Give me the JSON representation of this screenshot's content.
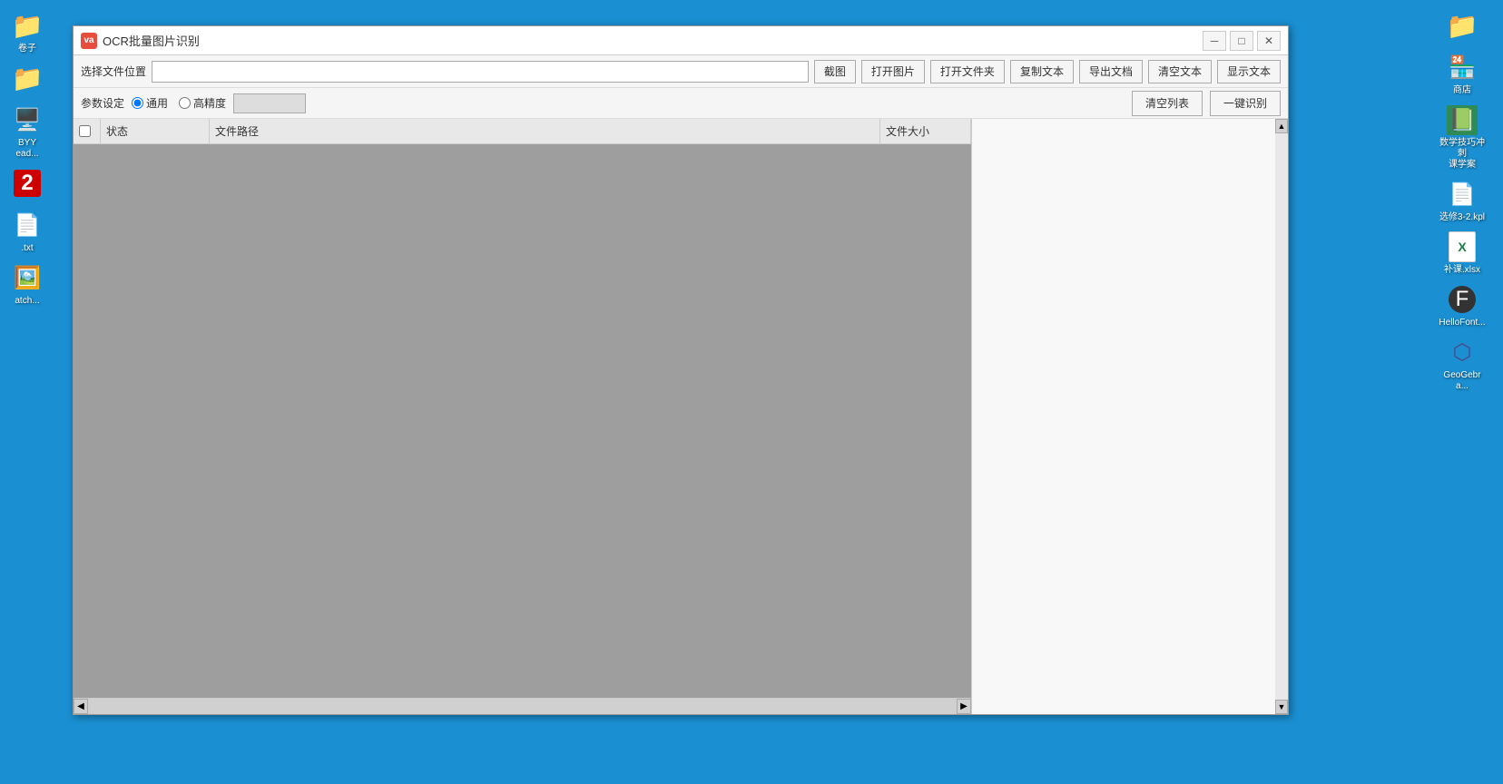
{
  "desktop": {
    "bg_color": "#1a8fd1",
    "left_icons": [
      {
        "id": "icon-1",
        "label": "卷子",
        "emoji": "📁"
      },
      {
        "id": "icon-2",
        "label": "",
        "emoji": "📁"
      },
      {
        "id": "icon-3",
        "label": "BYY\nead...",
        "emoji": "📁"
      },
      {
        "id": "icon-4",
        "label": "",
        "emoji": "🖼️"
      },
      {
        "id": "icon-5",
        "label": ".txt",
        "emoji": "📄"
      },
      {
        "id": "icon-6",
        "label": "atch...",
        "emoji": "🖼️"
      }
    ],
    "right_icons": [
      {
        "id": "r-icon-1",
        "label": "商店",
        "emoji": "🏪"
      },
      {
        "id": "r-icon-2",
        "label": "数学技巧冲刺\n课学案",
        "emoji": "📗"
      },
      {
        "id": "r-icon-3",
        "label": "选修3-2.kpl",
        "emoji": "📄"
      },
      {
        "id": "r-icon-4",
        "label": "补课.xlsx",
        "emoji": "📊"
      },
      {
        "id": "r-icon-5",
        "label": "HelloFont...",
        "emoji": "🔤"
      },
      {
        "id": "r-icon-6",
        "label": "GeoGebra...",
        "emoji": "⬡"
      }
    ]
  },
  "window": {
    "title": "OCR批量图片识别",
    "app_icon_text": "va",
    "min_label": "─",
    "max_label": "□",
    "close_label": "✕"
  },
  "toolbar": {
    "file_location_label": "选择文件位置",
    "file_location_value": "",
    "buttons": [
      {
        "id": "btn-screenshot",
        "label": "截图"
      },
      {
        "id": "btn-open-image",
        "label": "打开图片"
      },
      {
        "id": "btn-open-folder",
        "label": "打开文件夹"
      },
      {
        "id": "btn-copy-text",
        "label": "复制文本"
      },
      {
        "id": "btn-export-doc",
        "label": "导出文档"
      },
      {
        "id": "btn-clear-text",
        "label": "清空文本"
      },
      {
        "id": "btn-show-text",
        "label": "显示文本"
      }
    ]
  },
  "params": {
    "label": "参数设定",
    "radio_options": [
      {
        "id": "radio-normal",
        "label": "通用",
        "checked": true
      },
      {
        "id": "radio-high",
        "label": "高精度",
        "checked": false
      }
    ],
    "text_input_value": "",
    "clear_list_label": "清空列表",
    "one_click_label": "一键识别"
  },
  "table": {
    "columns": [
      {
        "id": "col-checkbox",
        "label": ""
      },
      {
        "id": "col-status",
        "label": "状态"
      },
      {
        "id": "col-path",
        "label": "文件路径"
      },
      {
        "id": "col-size",
        "label": "文件大小"
      }
    ],
    "rows": []
  },
  "text_panel": {
    "content": "",
    "cursor_visible": true
  }
}
